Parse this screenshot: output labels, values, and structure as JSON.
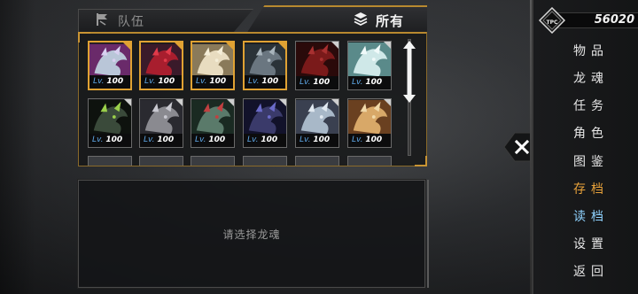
{
  "tabs": {
    "team_label": "队伍",
    "all_label": "所有"
  },
  "cards": [
    {
      "level_prefix": "Lv.",
      "level": "100",
      "selected": true
    },
    {
      "level_prefix": "Lv.",
      "level": "100",
      "selected": true
    },
    {
      "level_prefix": "Lv.",
      "level": "100",
      "selected": true
    },
    {
      "level_prefix": "Lv.",
      "level": "100",
      "selected": true
    },
    {
      "level_prefix": "Lv.",
      "level": "100",
      "selected": false
    },
    {
      "level_prefix": "Lv.",
      "level": "100",
      "selected": false
    },
    {
      "level_prefix": "Lv.",
      "level": "100",
      "selected": false
    },
    {
      "level_prefix": "Lv.",
      "level": "100",
      "selected": false
    },
    {
      "level_prefix": "Lv.",
      "level": "100",
      "selected": false
    },
    {
      "level_prefix": "Lv.",
      "level": "100",
      "selected": false
    },
    {
      "level_prefix": "Lv.",
      "level": "100",
      "selected": false
    },
    {
      "level_prefix": "Lv.",
      "level": "100",
      "selected": false
    }
  ],
  "detail": {
    "hint": "请选择龙魂"
  },
  "currency": {
    "badge_text": "TPC",
    "amount": "56020"
  },
  "menu": {
    "items": [
      {
        "label": "物品"
      },
      {
        "label": "龙魂"
      },
      {
        "label": "任务"
      },
      {
        "label": "角色"
      },
      {
        "label": "图鉴"
      },
      {
        "label": "存档"
      },
      {
        "label": "读档"
      },
      {
        "label": "设置"
      },
      {
        "label": "返回"
      }
    ]
  },
  "colors": {
    "accent_gold": "#e0a233",
    "save_highlight": "#e8a23a",
    "load_highlight": "#8fd3ff",
    "level_blue": "#5fa8e8"
  },
  "icons": {
    "team_tab": "flag-icon",
    "all_tab": "layers-icon",
    "close": "close-icon",
    "currency": "tpc-badge-icon"
  }
}
